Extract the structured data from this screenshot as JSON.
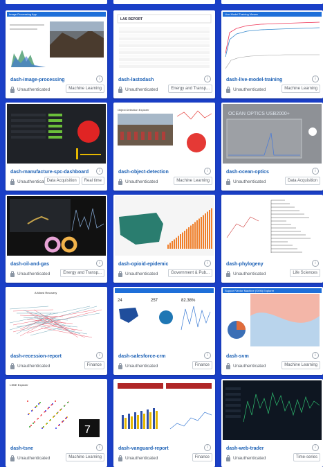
{
  "auth_label": "Unauthenticated",
  "apps": [
    {
      "name": "dash-image-processing",
      "tags": [
        "Machine Learning"
      ],
      "thumb_title": "Image Processing App"
    },
    {
      "name": "dash-lastodash",
      "tags": [
        "Energy and Transp..."
      ],
      "thumb_title": "LAS REPORT"
    },
    {
      "name": "dash-live-model-training",
      "tags": [
        "Machine Learning"
      ],
      "thumb_title": "Live Model Training Viewer"
    },
    {
      "name": "dash-manufacture-spc-dashboard",
      "tags": [
        "Data Acquisition",
        "Real time"
      ],
      "thumb_title": ""
    },
    {
      "name": "dash-object-detection",
      "tags": [
        "Machine Learning"
      ],
      "thumb_title": "Object Detection Explorer"
    },
    {
      "name": "dash-ocean-optics",
      "tags": [
        "Data Acquisition"
      ],
      "thumb_title": "OCEAN OPTICS USB2000+"
    },
    {
      "name": "dash-oil-and-gas",
      "tags": [
        "Energy and Transp..."
      ],
      "thumb_title": ""
    },
    {
      "name": "dash-opioid-epidemic",
      "tags": [
        "Government & Pub..."
      ],
      "thumb_title": ""
    },
    {
      "name": "dash-phylogeny",
      "tags": [
        "Life Sciences"
      ],
      "thumb_title": ""
    },
    {
      "name": "dash-recession-report",
      "tags": [
        "Finance"
      ],
      "thumb_title": "A Mixed Recovery"
    },
    {
      "name": "dash-salesforce-crm",
      "tags": [
        "Finance"
      ],
      "thumb_title": ""
    },
    {
      "name": "dash-svm",
      "tags": [
        "Machine Learning"
      ],
      "thumb_title": "Support Vector Machine (SVM) Explorer"
    },
    {
      "name": "dash-tsne",
      "tags": [
        "Machine Learning"
      ],
      "thumb_title": "t-SNE Explorer"
    },
    {
      "name": "dash-vanguard-report",
      "tags": [
        "Finance"
      ],
      "thumb_title": ""
    },
    {
      "name": "dash-web-trader",
      "tags": [
        "Time-series"
      ],
      "thumb_title": ""
    }
  ]
}
